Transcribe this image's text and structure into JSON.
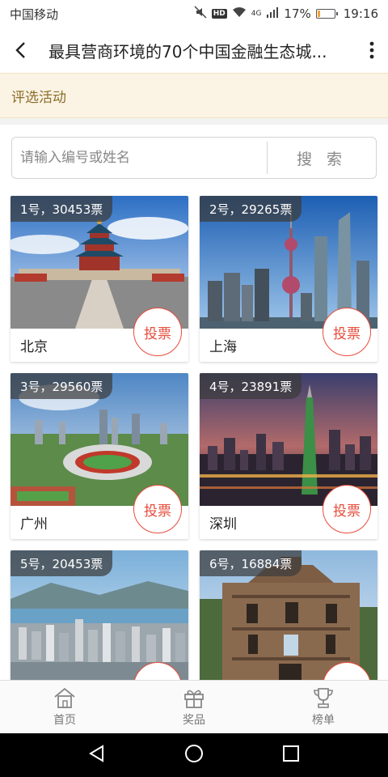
{
  "status_bar": {
    "carrier": "中国移动",
    "hd": "HD",
    "network": "4G",
    "battery_text": "17%",
    "battery_level": 0.17,
    "time": "19:16"
  },
  "app_bar": {
    "title": "最具营商环境的70个中国金融生态城..."
  },
  "notice": {
    "text": "评选活动"
  },
  "search": {
    "placeholder": "请输入编号或姓名",
    "button_label": "搜 索"
  },
  "vote_label": "投票",
  "cards": [
    {
      "badge": "1号，30453票",
      "name": "北京"
    },
    {
      "badge": "2号，29265票",
      "name": "上海"
    },
    {
      "badge": "3号，29560票",
      "name": "广州"
    },
    {
      "badge": "4号，23891票",
      "name": "深圳"
    },
    {
      "badge": "5号，20453票",
      "name": ""
    },
    {
      "badge": "6号，16884票",
      "name": ""
    }
  ],
  "tabs": [
    {
      "label": "首页",
      "icon": "home-icon"
    },
    {
      "label": "奖品",
      "icon": "gift-icon"
    },
    {
      "label": "榜单",
      "icon": "trophy-icon"
    }
  ],
  "colors": {
    "accent": "#e74c3c",
    "notice_bg": "#fbf4e4",
    "notice_text": "#8b6d2a"
  }
}
